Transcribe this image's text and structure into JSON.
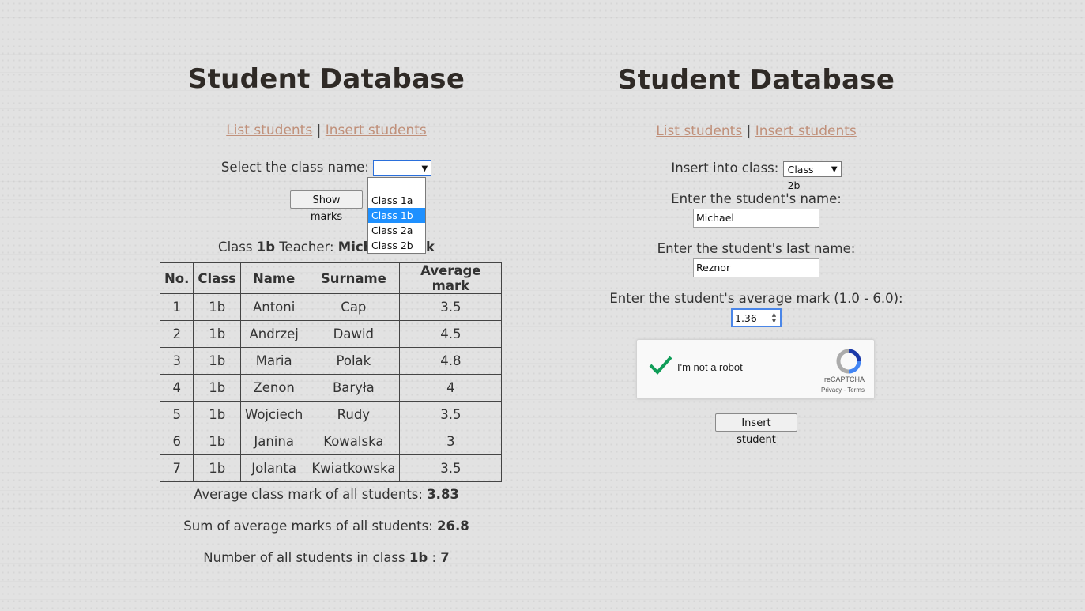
{
  "left": {
    "title": "Student Database",
    "nav": {
      "list_label": "List students",
      "separator": "|",
      "insert_label": "Insert students"
    },
    "select_label": "Select the class name:",
    "select_value": "",
    "dropdown_options": [
      "",
      "Class 1a",
      "Class 1b",
      "Class 2a",
      "Class 2b"
    ],
    "dropdown_selected": "Class 1b",
    "show_marks_label": "Show marks",
    "class_info": {
      "prefix": "Class",
      "class_name": "1b",
      "teacher_label": "Teacher:",
      "teacher_name": "Michał Kozak"
    },
    "table": {
      "headers": [
        "No.",
        "Class",
        "Name",
        "Surname",
        "Average mark"
      ],
      "rows": [
        [
          "1",
          "1b",
          "Antoni",
          "Cap",
          "3.5"
        ],
        [
          "2",
          "1b",
          "Andrzej",
          "Dawid",
          "4.5"
        ],
        [
          "3",
          "1b",
          "Maria",
          "Polak",
          "4.8"
        ],
        [
          "4",
          "1b",
          "Zenon",
          "Baryła",
          "4"
        ],
        [
          "5",
          "1b",
          "Wojciech",
          "Rudy",
          "3.5"
        ],
        [
          "6",
          "1b",
          "Janina",
          "Kowalska",
          "3"
        ],
        [
          "7",
          "1b",
          "Jolanta",
          "Kwiatkowska",
          "3.5"
        ]
      ]
    },
    "summary": {
      "avg_label": "Average class mark of all students:",
      "avg_value": "3.83",
      "sum_label": "Sum of average marks of all students:",
      "sum_value": "26.8",
      "count_label": "Number of all students in class",
      "count_class": "1b",
      "count_sep": ":",
      "count_value": "7"
    }
  },
  "right": {
    "title": "Student Database",
    "nav": {
      "list_label": "List students",
      "separator": "|",
      "insert_label": "Insert students"
    },
    "class_label": "Insert into class:",
    "class_value": "Class 2b",
    "name_label": "Enter the student's name:",
    "name_value": "Michael",
    "lastname_label": "Enter the student's last name:",
    "lastname_value": "Reznor",
    "mark_label": "Enter the student's average mark (1.0 - 6.0):",
    "mark_value": "1.36",
    "recaptcha": {
      "label": "I'm not a robot",
      "brand": "reCAPTCHA",
      "privacy": "Privacy",
      "terms": "Terms",
      "checked": true
    },
    "submit_label": "Insert student"
  },
  "colors": {
    "link": "#c0907a",
    "title": "#2f2a26",
    "dropdown_highlight": "#1e90ff",
    "check": "#0f9d58"
  }
}
